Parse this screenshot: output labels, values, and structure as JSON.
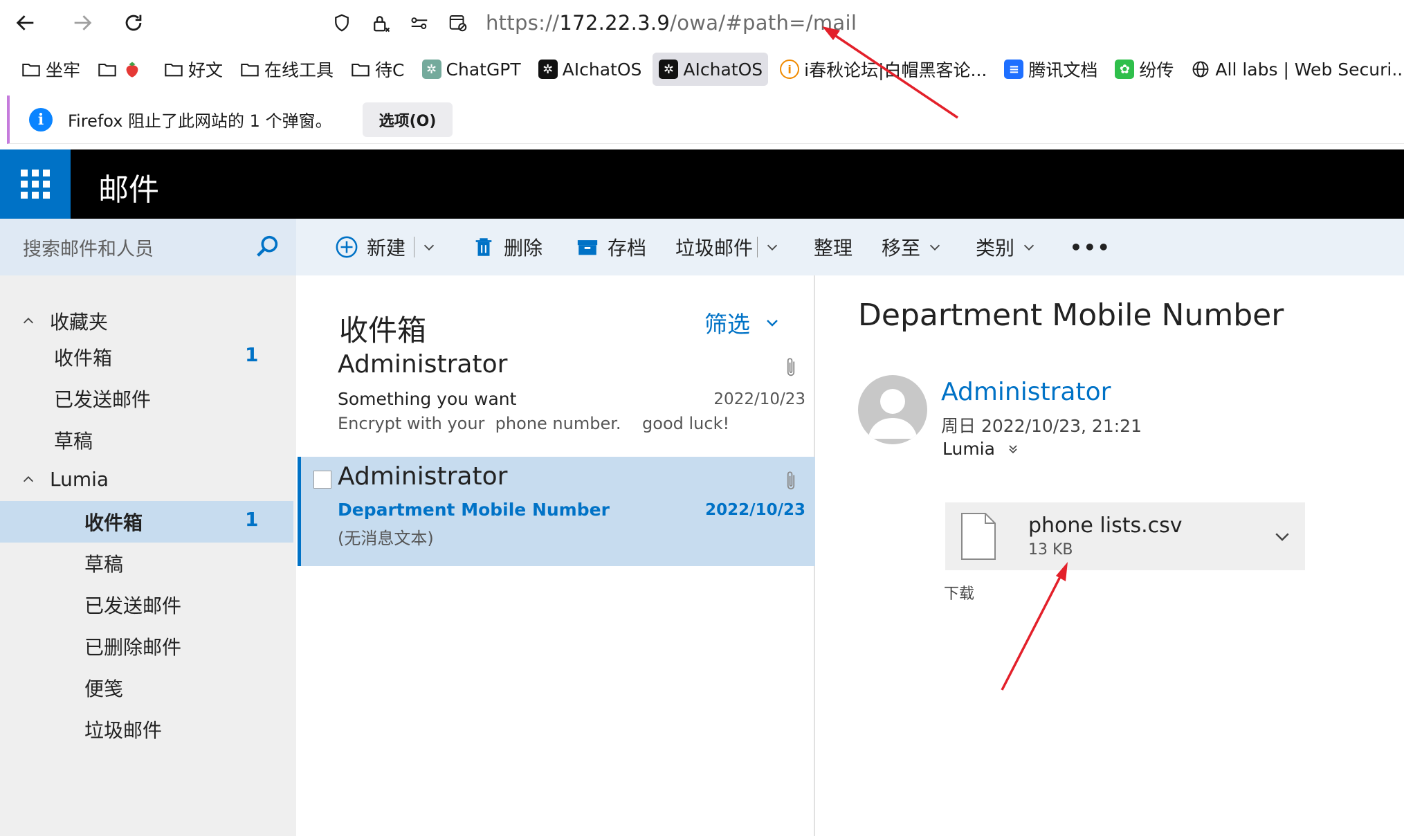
{
  "browser": {
    "url_prefix": "https://",
    "url_host": "172.22.3.9",
    "url_path": "/owa/#path=/mail"
  },
  "bookmarks": [
    {
      "label": "坐牢",
      "icon": "folder-icon"
    },
    {
      "label": "",
      "icon": "folder-icon"
    },
    {
      "label": "好文",
      "icon": "folder-icon"
    },
    {
      "label": "在线工具",
      "icon": "folder-icon"
    },
    {
      "label": "待C",
      "icon": "folder-icon"
    },
    {
      "label": "ChatGPT",
      "icon": "openai-icon"
    },
    {
      "label": "AIchatOS",
      "icon": "openai-icon"
    },
    {
      "label": "AIchatOS",
      "icon": "openai-icon"
    },
    {
      "label": "i春秋论坛|白帽黑客论...",
      "icon": "ichunqiu-icon"
    },
    {
      "label": "腾讯文档",
      "icon": "tencent-docs-icon"
    },
    {
      "label": "纷传",
      "icon": "fenchuan-icon"
    },
    {
      "label": "All labs | Web Securi...",
      "icon": "globe-icon"
    }
  ],
  "popup": {
    "message": "Firefox 阻止了此网站的 1 个弹窗。",
    "options_button": "选项(O)"
  },
  "app": {
    "title": "邮件"
  },
  "search": {
    "placeholder": "搜索邮件和人员"
  },
  "commands": {
    "new": "新建",
    "delete": "删除",
    "archive": "存档",
    "junk": "垃圾邮件",
    "sweep": "整理",
    "move_to": "移至",
    "categorize": "类别",
    "more": "•••"
  },
  "nav": {
    "favorites": {
      "label": "收藏夹",
      "items": [
        {
          "label": "收件箱",
          "count": "1"
        },
        {
          "label": "已发送邮件",
          "count": ""
        },
        {
          "label": "草稿",
          "count": ""
        }
      ]
    },
    "account": {
      "label": "Lumia",
      "items": [
        {
          "label": "收件箱",
          "count": "1"
        },
        {
          "label": "草稿",
          "count": ""
        },
        {
          "label": "已发送邮件",
          "count": ""
        },
        {
          "label": "已删除邮件",
          "count": ""
        },
        {
          "label": "便笺",
          "count": ""
        },
        {
          "label": "垃圾邮件",
          "count": ""
        }
      ]
    }
  },
  "list": {
    "title": "收件箱",
    "filter": "筛选",
    "messages": [
      {
        "from": "Administrator",
        "subject": "Something you want",
        "date": "2022/10/23",
        "preview": "Encrypt with your  phone number.    good luck!"
      },
      {
        "from": "Administrator",
        "subject": "Department Mobile Number",
        "date": "2022/10/23",
        "preview": "(无消息文本)"
      }
    ]
  },
  "reading": {
    "subject": "Department Mobile Number",
    "sender": "Administrator",
    "sent": "周日 2022/10/23, 21:21",
    "to": "Lumia",
    "attachment": {
      "name": "phone lists.csv",
      "size": "13 KB",
      "download": "下载"
    }
  },
  "colors": {
    "accent": "#0072c6",
    "selected_bg": "#c7dcef",
    "annotation": "#e3202a"
  }
}
